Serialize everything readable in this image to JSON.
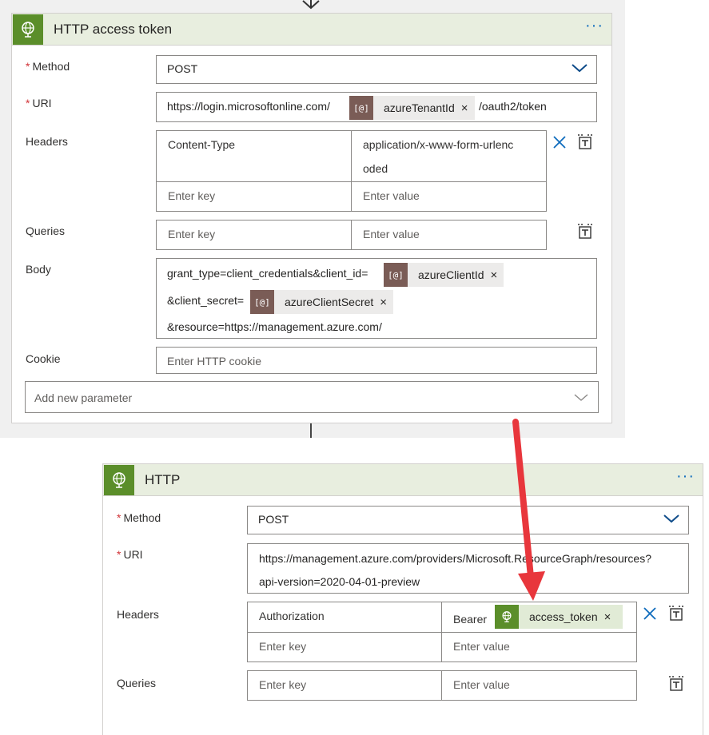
{
  "card1": {
    "title": "HTTP access token",
    "more": "···",
    "method": {
      "label": "Method",
      "value": "POST"
    },
    "uri": {
      "label": "URI",
      "prefix": "https://login.microsoftonline.com/",
      "token": {
        "icon_text": "[@]",
        "label": "azureTenantId"
      },
      "suffix": "/oauth2/token"
    },
    "headers": {
      "label": "Headers",
      "rows": [
        {
          "key": "Content-Type",
          "value_line1": "application/x-www-form-urlenc",
          "value_line2": "oded"
        }
      ],
      "key_placeholder": "Enter key",
      "value_placeholder": "Enter value"
    },
    "queries": {
      "label": "Queries",
      "key_placeholder": "Enter key",
      "value_placeholder": "Enter value"
    },
    "body": {
      "label": "Body",
      "line1_text": "grant_type=client_credentials&client_id=",
      "token1": {
        "icon_text": "[@]",
        "label": "azureClientId"
      },
      "line2_text": "&client_secret=",
      "token2": {
        "icon_text": "[@]",
        "label": "azureClientSecret"
      },
      "line3_text": "&resource=https://management.azure.com/"
    },
    "cookie": {
      "label": "Cookie",
      "placeholder": "Enter HTTP cookie"
    },
    "add_param": {
      "placeholder": "Add new parameter"
    }
  },
  "card2": {
    "title": "HTTP",
    "more": "···",
    "method": {
      "label": "Method",
      "value": "POST"
    },
    "uri": {
      "label": "URI",
      "line1": "https://management.azure.com/providers/Microsoft.ResourceGraph/resources?",
      "line2": "api-version=2020-04-01-preview"
    },
    "headers": {
      "label": "Headers",
      "rows": [
        {
          "key": "Authorization",
          "value_prefix": "Bearer",
          "token": {
            "label": "access_token"
          }
        }
      ],
      "key_placeholder": "Enter key",
      "value_placeholder": "Enter value"
    },
    "queries": {
      "label": "Queries",
      "key_placeholder": "Enter key",
      "value_placeholder": "Enter value"
    }
  },
  "common": {
    "remove_x": "×",
    "required_mark": "*"
  },
  "colors": {
    "header_bg": "#e8eedf",
    "connector_icon_bg": "#5b8e2a",
    "token_icon_bg": "#7a5c56",
    "annotation_arrow": "#e8363c",
    "accent": "#0f6cbd"
  }
}
